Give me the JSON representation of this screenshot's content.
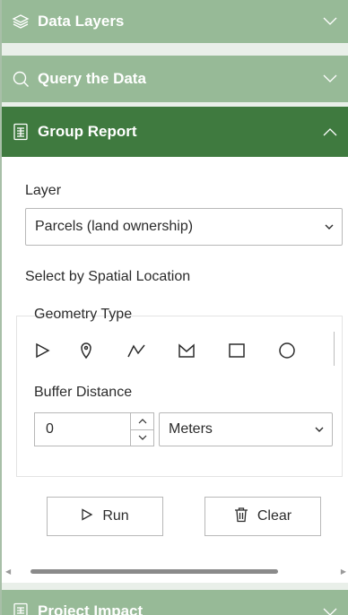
{
  "accordion": {
    "data_layers": {
      "title": "Data Layers",
      "icon": "layers-icon"
    },
    "query": {
      "title": "Query the Data",
      "icon": "search-icon"
    },
    "group_report": {
      "title": "Group Report",
      "icon": "report-icon"
    },
    "project_impact": {
      "title": "Project Impact",
      "icon": "report-icon"
    }
  },
  "form": {
    "layer_label": "Layer",
    "layer_value": "Parcels (land ownership)",
    "spatial_label": "Select by Spatial Location",
    "geometry_label": "Geometry Type",
    "geometry_tools": [
      "point-tool-icon",
      "pin-tool-icon",
      "polyline-tool-icon",
      "polygon-tool-icon",
      "rectangle-tool-icon",
      "circle-tool-icon"
    ],
    "buffer_label": "Buffer Distance",
    "buffer_value": "0",
    "unit_value": "Meters",
    "run_label": "Run",
    "clear_label": "Clear"
  },
  "colors": {
    "header_light": "#97ba97",
    "header_active": "#3f7a3f",
    "text": "#2b2b2b"
  }
}
